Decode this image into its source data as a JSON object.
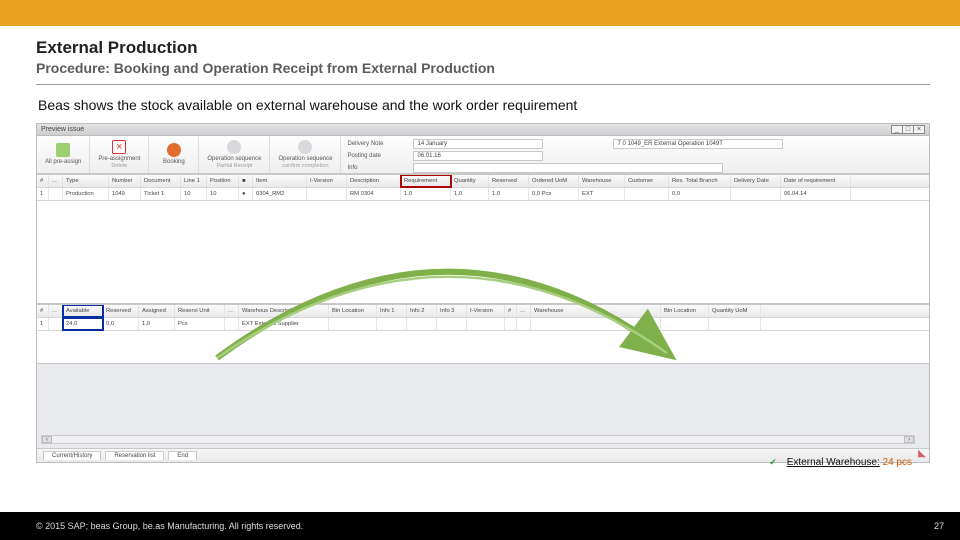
{
  "header": {
    "title": "External Production",
    "subtitle": "Procedure: Booking and Operation Receipt from External Production"
  },
  "description": "Beas shows the stock available on external warehouse and the work order requirement",
  "app": {
    "window_title": "Preview issue",
    "toolbar": {
      "preassign": {
        "label": "All pre-assign",
        "sub": ""
      },
      "delassign": {
        "label": "Pre-assignment",
        "sub": "Delete"
      },
      "booking": {
        "label": "Booking",
        "sub": ""
      },
      "oseq": {
        "label": "Operation sequence",
        "sub": "Partial Receipt"
      },
      "oseq2": {
        "label": "Operation sequence",
        "sub": "confirm completion"
      }
    },
    "form": {
      "delivery_label": "Delivery Note",
      "delivery_value": "14 January",
      "info_label": "",
      "info_value": "7 0 1049_ER  External Operation 1049T",
      "posting_label": "Posting date",
      "posting_value": "06.01.16",
      "info2_label": "Info",
      "info2_value": ""
    },
    "grid1": {
      "cols": [
        "#",
        "...",
        "Type",
        "Number",
        "Document",
        "Line 1",
        "Position",
        "■",
        "Item",
        "I-Version",
        "Description",
        "Requirement",
        "Quantity",
        "Reserved",
        "Ordered UoM",
        "Warehouse",
        "Customer",
        "Res. Total Branch",
        "Delivery Date",
        "Date of requirement"
      ],
      "widths": [
        12,
        14,
        46,
        32,
        40,
        26,
        32,
        14,
        54,
        40,
        54,
        50,
        38,
        40,
        50,
        46,
        44,
        62,
        50,
        70
      ],
      "row": [
        "1",
        "",
        "Production",
        "1049",
        "Ticket 1",
        "10",
        "10",
        "●",
        "0304_RM2",
        "",
        "RM 0304",
        "1,0",
        "1,0",
        "1,0",
        "0,0  Pcs",
        "EXT",
        "",
        "0,0",
        "",
        "06.04.14"
      ]
    },
    "grid2": {
      "cols": [
        "#",
        "...",
        "Available",
        "Reserved",
        "Assigned",
        "Reservi Unit",
        "...",
        "Warehous Description",
        "Bin Location",
        "Info 1",
        "Info 2",
        "Info 3",
        "I-Version",
        "#",
        "...",
        "Warehouse",
        "Bin Location",
        "Quantity UoM"
      ],
      "widths": [
        12,
        14,
        40,
        36,
        36,
        50,
        14,
        90,
        48,
        30,
        30,
        30,
        38,
        12,
        14,
        130,
        48,
        52
      ],
      "row": [
        "1",
        "",
        "24,0",
        "0,0",
        "1,0",
        "Pcs",
        "",
        "EXT      External Supplier",
        "",
        "",
        "",
        "",
        "",
        "",
        "",
        "",
        "",
        ""
      ]
    },
    "tabs": {
      "a": "Current/History",
      "b": "Reservation list",
      "c": "End"
    }
  },
  "callout": {
    "label": "External Warehouse:",
    "value": "24 pcs"
  },
  "footer": {
    "copyright": "© 2015 SAP; beas Group, be.as Manufacturing.  All rights reserved.",
    "page": "27"
  },
  "colors": {
    "accent": "#eaa321",
    "mark_red": "#aa0606",
    "mark_blue": "#0a2ea0",
    "arrow": "#7fb04a"
  }
}
